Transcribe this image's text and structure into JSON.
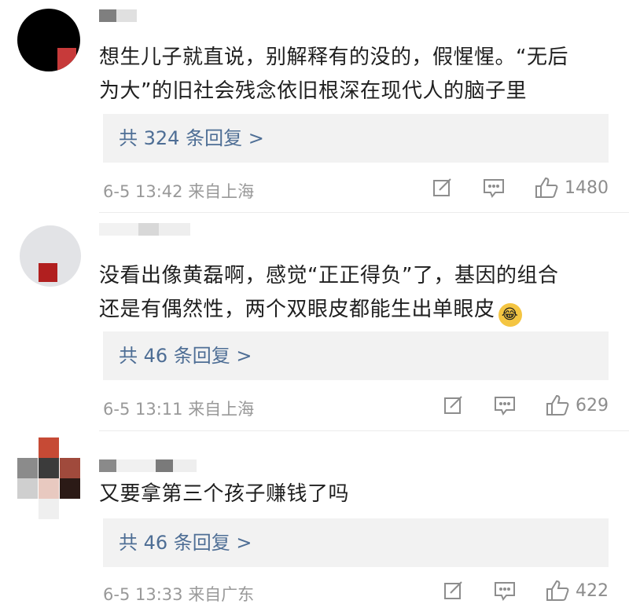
{
  "comments": [
    {
      "text": "想生儿子就直说，别解释有的没的，假惺惺。“无后\n为大”的旧社会残念依旧根深在现代人的脑子里",
      "emoji": "",
      "replies": "共 324 条回复 >",
      "time": "6-5 13:42",
      "location": "来自上海",
      "likes": "1480"
    },
    {
      "text": "没看出像黄磊啊，感觉“正正得负”了，基因的组合\n还是有偶然性，两个双眼皮都能生出单眼皮",
      "emoji": "😂",
      "replies": "共 46 条回复 >",
      "time": "6-5 13:11",
      "location": "来自上海",
      "likes": "629"
    },
    {
      "text": "又要拿第三个孩子赚钱了吗",
      "emoji": "",
      "replies": "共 46 条回复 >",
      "time": "6-5 13:33",
      "location": "来自广东",
      "likes": "422"
    }
  ],
  "icons": {
    "share": "share-edit-icon",
    "comment": "comment-icon",
    "like": "thumbs-up-icon"
  },
  "colors": {
    "reply_link": "#4e6e95",
    "meta": "#999999",
    "reply_bg": "#f2f2f2"
  }
}
